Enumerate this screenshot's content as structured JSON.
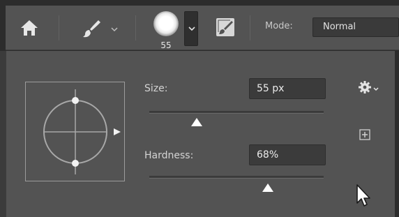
{
  "toolbar": {
    "home_icon": "home-icon",
    "brush_icon": "brush-icon",
    "brush_size_value": "55",
    "mode_label": "Mode:",
    "mode_value": "Normal"
  },
  "panel": {
    "size_label": "Size:",
    "size_value": "55 px",
    "size_slider_fraction": 0.27,
    "hardness_label": "Hardness:",
    "hardness_value": "68%",
    "hardness_slider_fraction": 0.68,
    "settings_icon": "gear-icon",
    "new_preset_icon": "new-preset-icon"
  },
  "colors": {
    "panel_bg": "#535353",
    "field_bg": "#3b3b3b",
    "text": "#d4d4d4",
    "thumb": "#ffffff"
  }
}
